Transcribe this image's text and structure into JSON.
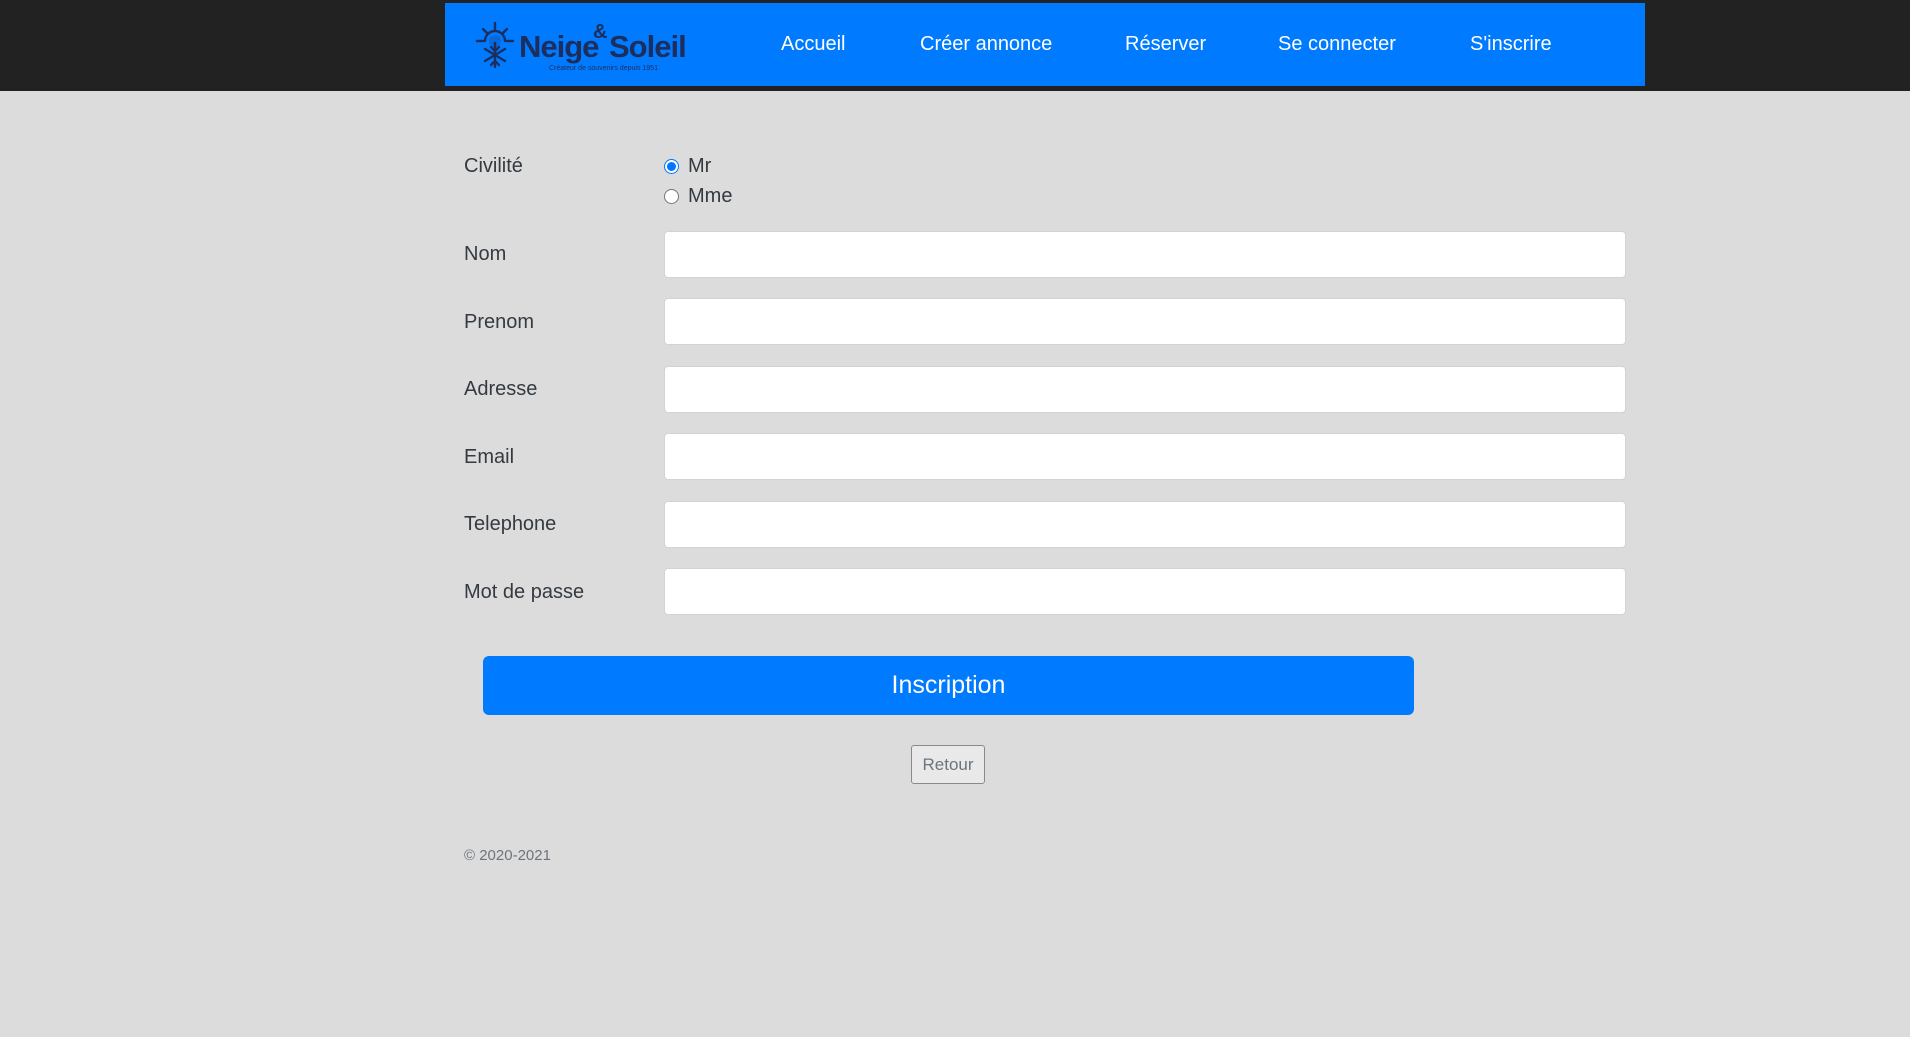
{
  "brand": {
    "logo_word1": "Neige",
    "logo_amp": "&",
    "logo_word2": "Soleil",
    "logo_tagline": "Créateur de souvenirs depuis 1951",
    "primary_color": "#007bff",
    "logo_color": "#1c2e5e"
  },
  "nav": {
    "items": [
      {
        "label": "Accueil"
      },
      {
        "label": "Créer annonce"
      },
      {
        "label": "Réserver"
      },
      {
        "label": "Se connecter"
      },
      {
        "label": "S'inscrire"
      }
    ]
  },
  "form": {
    "civilite": {
      "label": "Civilité",
      "options": [
        {
          "label": "Mr",
          "checked": true
        },
        {
          "label": "Mme",
          "checked": false
        }
      ]
    },
    "fields": [
      {
        "label": "Nom",
        "value": ""
      },
      {
        "label": "Prenom",
        "value": ""
      },
      {
        "label": "Adresse",
        "value": ""
      },
      {
        "label": "Email",
        "value": ""
      },
      {
        "label": "Telephone",
        "value": ""
      },
      {
        "label": "Mot de passe",
        "value": ""
      }
    ],
    "submit_label": "Inscription",
    "back_label": "Retour"
  },
  "footer": {
    "copyright": "© 2020-2021"
  }
}
